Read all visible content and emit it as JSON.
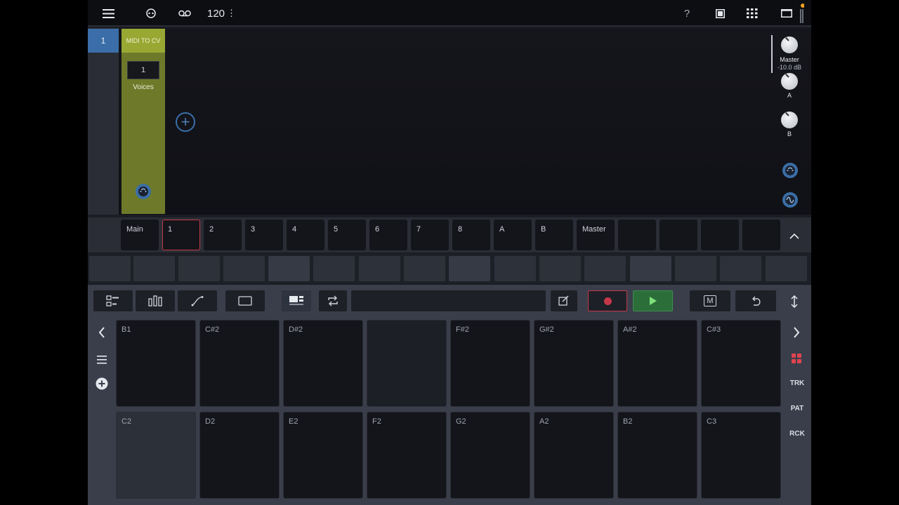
{
  "topbar": {
    "menu_icon": "hamburger-icon",
    "link_icon": "link-icon",
    "tape_icon": "tape-icon",
    "tempo": "120",
    "tempo_more": "⋮",
    "help": "?",
    "window_icon": "window-icon",
    "grid_icon": "grid-icon",
    "layout_icon": "layout-icon",
    "meter_icon": "level-meter-icon"
  },
  "rack": {
    "channel_number": "1",
    "device": {
      "title": "MIDI TO CV",
      "voices_value": "1",
      "voices_label": "Voices"
    },
    "add_device_icon": "plus-circle-icon",
    "master_knob": {
      "label": "Master",
      "value": "-10.0 dB"
    },
    "knob_a": {
      "label": "A"
    },
    "knob_b": {
      "label": "B"
    },
    "midi_port_icon": "midi-port-icon",
    "audio_port_icon": "wave-icon"
  },
  "tabs": [
    {
      "label": "Main"
    },
    {
      "label": "1"
    },
    {
      "label": "2"
    },
    {
      "label": "3"
    },
    {
      "label": "4"
    },
    {
      "label": "5"
    },
    {
      "label": "6"
    },
    {
      "label": "7"
    },
    {
      "label": "8"
    },
    {
      "label": "A"
    },
    {
      "label": "B"
    },
    {
      "label": "Master"
    },
    {
      "label": ""
    },
    {
      "label": ""
    },
    {
      "label": ""
    },
    {
      "label": ""
    }
  ],
  "selected_tab": "1",
  "toolbar": {
    "sequencer_icon": "step-sequencer-icon",
    "mixer_icon": "mixer-icon",
    "automation_icon": "automation-icon",
    "blank_icon": "rectangle-icon",
    "keyboard_icon": "keyboard-icon",
    "loop_icon": "loop-icon",
    "edit_icon": "edit-icon",
    "record_icon": "record-icon",
    "play_icon": "play-icon",
    "metronome_label": "M",
    "undo_icon": "undo-icon",
    "expand_icon": "expand-vertical-icon"
  },
  "pad_nav": {
    "prev_icon": "chevron-left-icon",
    "next_icon": "chevron-right-icon",
    "list_icon": "list-icon",
    "add_icon": "plus-icon",
    "pads_icon": "pads-icon",
    "trk": "TRK",
    "pat": "PAT",
    "rck": "RCK"
  },
  "pads_top": [
    "B1",
    "C#2",
    "D#2",
    "",
    "F#2",
    "G#2",
    "A#2",
    "C#3"
  ],
  "pads_bottom": [
    "C2",
    "D2",
    "E2",
    "F2",
    "G2",
    "A2",
    "B2",
    "C3"
  ],
  "colors": {
    "accent_blue": "#3b6ea8",
    "device_green": "#98a833",
    "record_red": "#c4384a",
    "play_green": "#2c6e3a"
  }
}
